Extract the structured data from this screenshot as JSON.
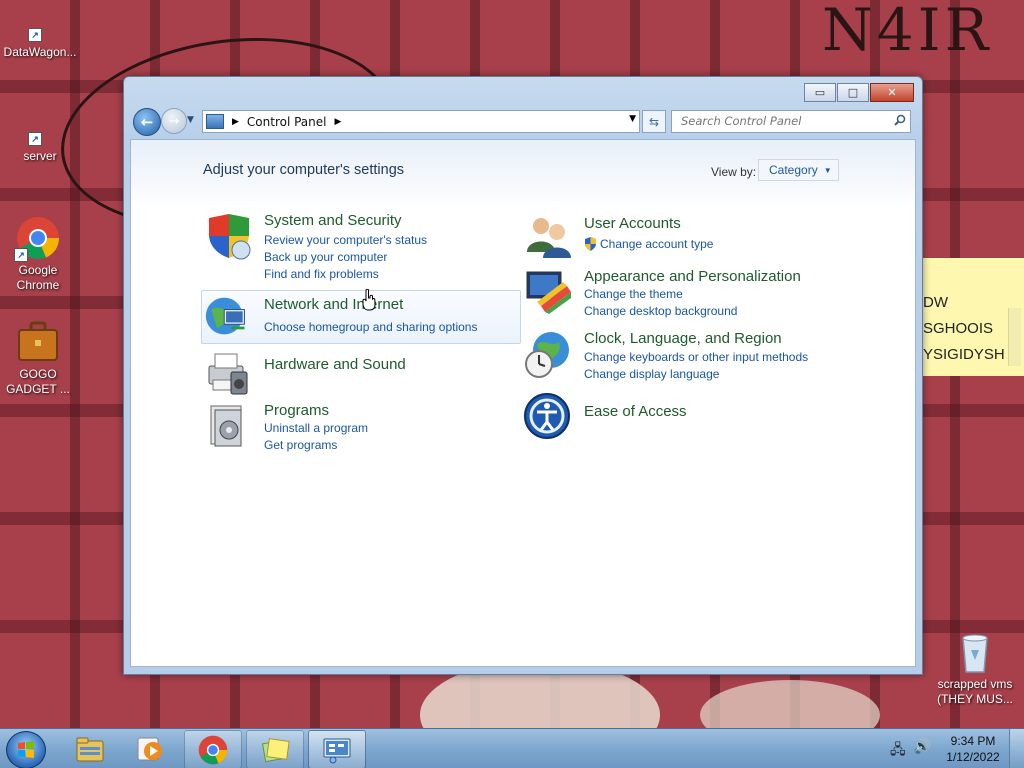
{
  "desktop": {
    "wallpaper_text": "N4IR",
    "icons": [
      {
        "label": "DataWagon...",
        "icon": "shortcut-icon"
      },
      {
        "label": "server",
        "icon": "shortcut-icon"
      },
      {
        "label": "Google Chrome",
        "icon": "chrome-icon"
      },
      {
        "label": "GOGO GADGET ...",
        "icon": "briefcase-icon"
      },
      {
        "label": "scrapped vms (THEY MUS...",
        "icon": "recycle-bin-icon"
      }
    ],
    "sticky_note": {
      "lines": [
        "DW",
        "SGHOOIS",
        "YSIGIDYSH"
      ]
    }
  },
  "window": {
    "title_buttons": {
      "minimize": "▭",
      "maximize": "□",
      "close": "✕"
    },
    "address": {
      "root": "Control Panel"
    },
    "search": {
      "placeholder": "Search Control Panel"
    },
    "page_title": "Adjust your computer's settings",
    "view_by": {
      "label": "View by:",
      "value": "Category"
    },
    "categories_left": [
      {
        "title": "System and Security",
        "links": [
          "Review your computer's status",
          "Back up your computer",
          "Find and fix problems"
        ],
        "icon": "shield-icon"
      },
      {
        "title": "Network and Internet",
        "links": [
          "Choose homegroup and sharing options"
        ],
        "icon": "network-globe-icon"
      },
      {
        "title": "Hardware and Sound",
        "links": [],
        "icon": "printer-icon"
      },
      {
        "title": "Programs",
        "links": [
          "Uninstall a program",
          "Get programs"
        ],
        "icon": "programs-icon"
      }
    ],
    "categories_right": [
      {
        "title": "User Accounts",
        "links": [
          "Change account type"
        ],
        "icon": "users-icon"
      },
      {
        "title": "Appearance and Personalization",
        "links": [
          "Change the theme",
          "Change desktop background"
        ],
        "icon": "appearance-icon"
      },
      {
        "title": "Clock, Language, and Region",
        "links": [
          "Change keyboards or other input methods",
          "Change display language"
        ],
        "icon": "clock-globe-icon"
      },
      {
        "title": "Ease of Access",
        "links": [],
        "icon": "ease-of-access-icon"
      }
    ]
  },
  "taskbar": {
    "clock_time": "9:34 PM",
    "clock_date": "1/12/2022",
    "pinned": [
      "explorer-icon",
      "media-player-icon",
      "chrome-icon",
      "sticky-notes-icon",
      "control-panel-icon"
    ]
  },
  "colors": {
    "link": "#1a55a6",
    "category_title": "#1e5a2c",
    "wallpaper": "#a8404b"
  }
}
